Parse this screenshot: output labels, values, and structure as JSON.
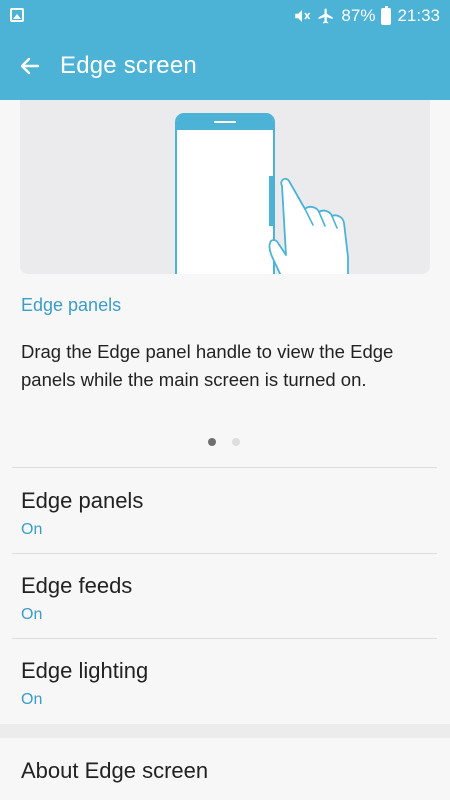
{
  "status_bar": {
    "battery": "87%",
    "time": "21:33",
    "icons": [
      "gallery-icon",
      "mute-icon",
      "airplane-icon",
      "battery-icon"
    ]
  },
  "app_bar": {
    "title": "Edge screen",
    "back_icon": "back-arrow-icon"
  },
  "illustration": {
    "icon": "phone-edge-swipe-illustration"
  },
  "intro": {
    "section_label": "Edge panels",
    "description": "Drag the Edge panel handle to view the Edge panels while the main screen is turned on.",
    "page_count": 2,
    "active_page": 1
  },
  "settings": [
    {
      "title": "Edge panels",
      "status": "On"
    },
    {
      "title": "Edge feeds",
      "status": "On"
    },
    {
      "title": "Edge lighting",
      "status": "On"
    }
  ],
  "about": {
    "title": "About Edge screen"
  },
  "colors": {
    "accent": "#4cb3d6",
    "link": "#3a9ec7",
    "background": "#f7f7f7"
  }
}
